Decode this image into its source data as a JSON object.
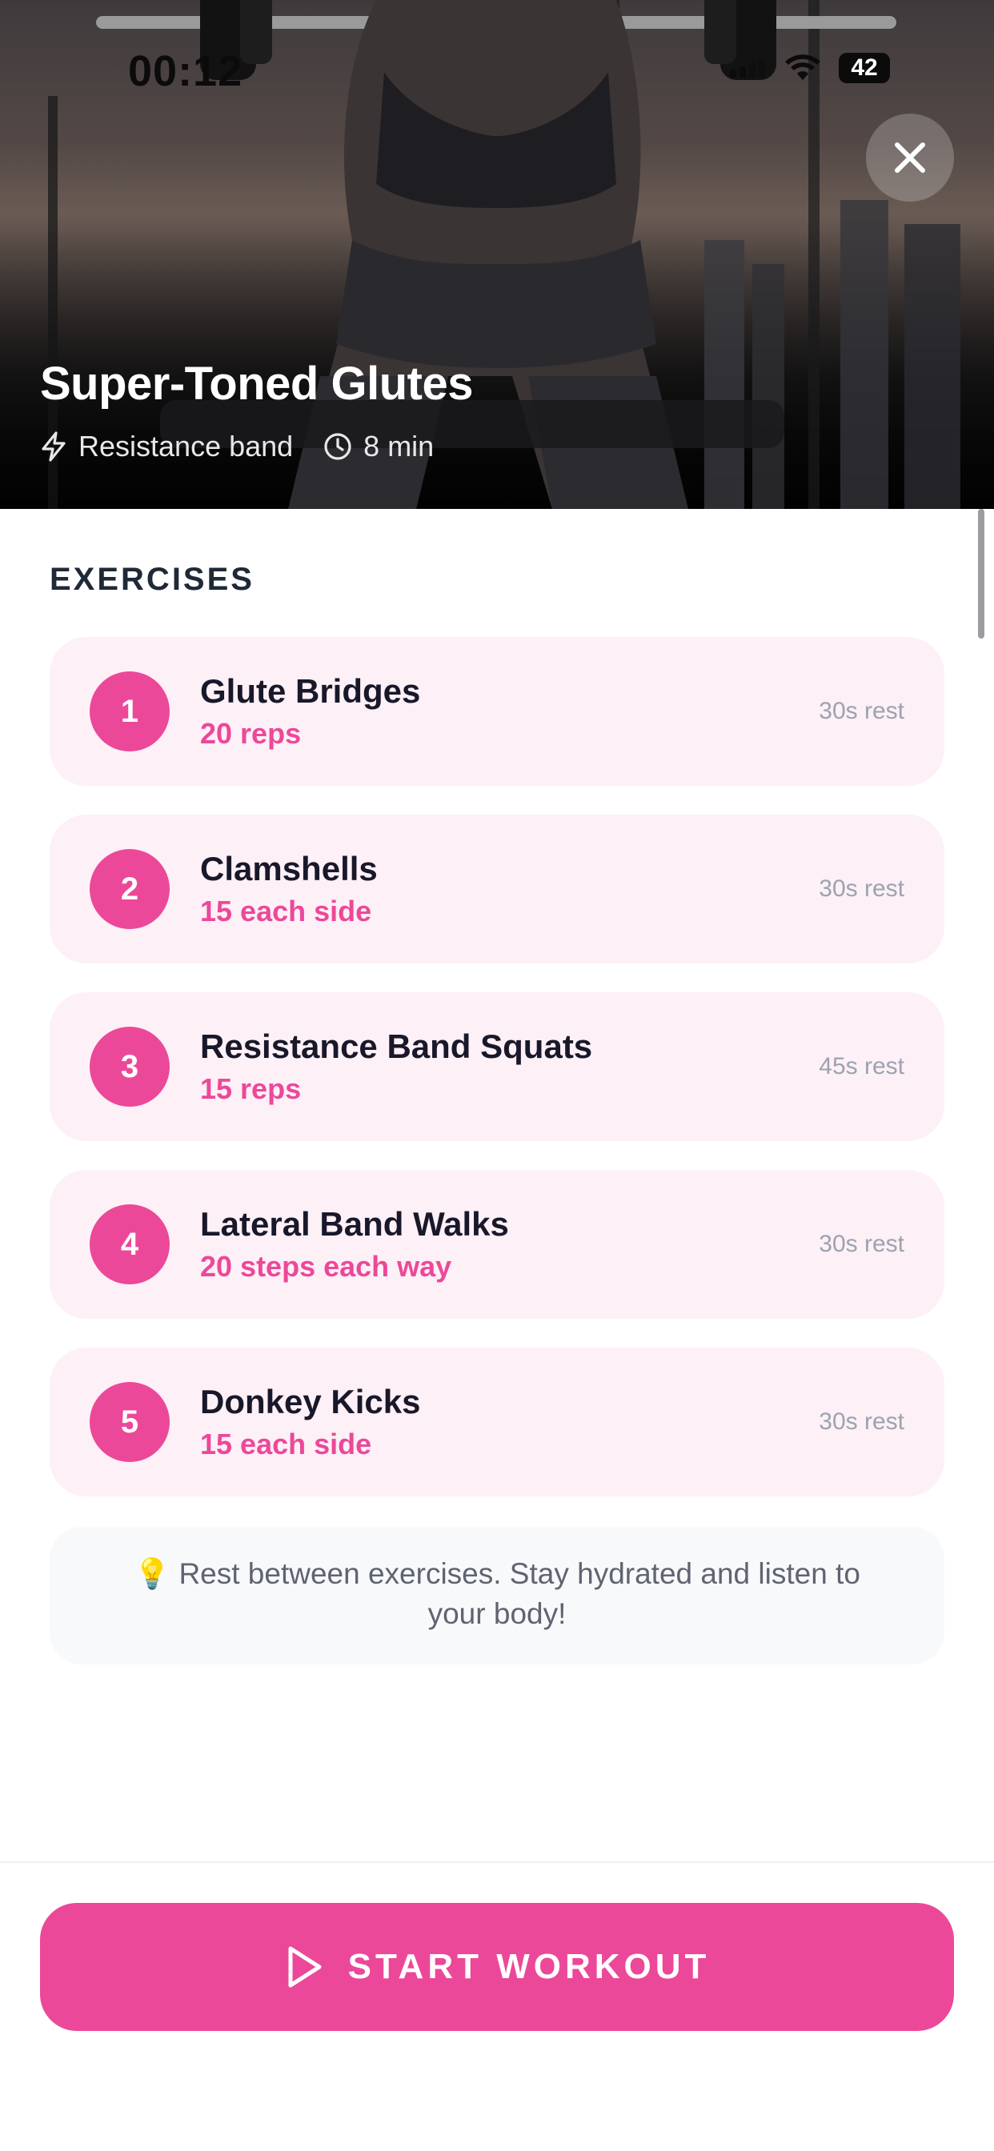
{
  "status_bar": {
    "time": "00:12",
    "battery": "42"
  },
  "hero": {
    "title": "Super-Toned Glutes",
    "equipment": "Resistance band",
    "duration": "8 min"
  },
  "section": {
    "title": "EXERCISES"
  },
  "exercises": [
    {
      "number": "1",
      "name": "Glute Bridges",
      "reps": "20 reps",
      "rest": "30s rest"
    },
    {
      "number": "2",
      "name": "Clamshells",
      "reps": "15 each side",
      "rest": "30s rest"
    },
    {
      "number": "3",
      "name": "Resistance Band Squats",
      "reps": "15 reps",
      "rest": "45s rest"
    },
    {
      "number": "4",
      "name": "Lateral Band Walks",
      "reps": "20 steps each way",
      "rest": "30s rest"
    },
    {
      "number": "5",
      "name": "Donkey Kicks",
      "reps": "15 each side",
      "rest": "30s rest"
    }
  ],
  "tip": {
    "icon": "lightbulb-icon",
    "glyph": "💡",
    "text": "Rest between exercises. Stay hydrated and listen to your body!"
  },
  "start_button": {
    "label": "START WORKOUT"
  },
  "colors": {
    "accent": "#ec4899",
    "card_bg": "#fdf0f6",
    "tip_bg": "#f8f9fb"
  }
}
